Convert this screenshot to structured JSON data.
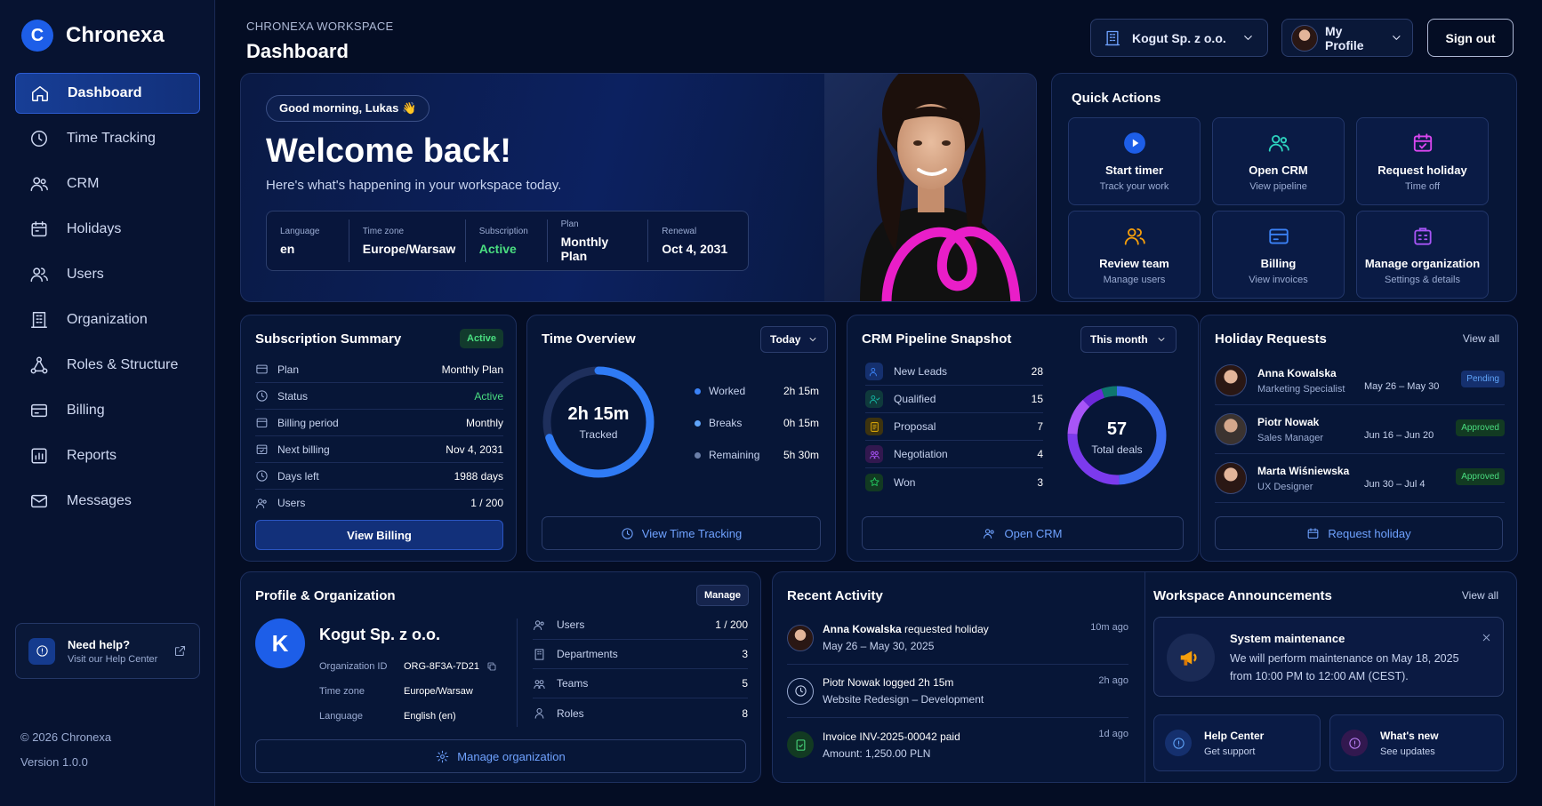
{
  "brand": {
    "name": "Chronexa",
    "logo_letter": "C"
  },
  "nav": {
    "items": [
      {
        "label": "Dashboard",
        "icon": "home-icon"
      },
      {
        "label": "Time Tracking",
        "icon": "clock-icon"
      },
      {
        "label": "CRM",
        "icon": "users-icon"
      },
      {
        "label": "Holidays",
        "icon": "calendar-icon"
      },
      {
        "label": "Users",
        "icon": "user-icon"
      },
      {
        "label": "Organization",
        "icon": "building-icon"
      },
      {
        "label": "Roles & Structure",
        "icon": "hierarchy-icon"
      },
      {
        "label": "Billing",
        "icon": "card-icon"
      },
      {
        "label": "Reports",
        "icon": "chart-icon"
      },
      {
        "label": "Messages",
        "icon": "mail-icon"
      }
    ]
  },
  "help": {
    "title": "Need help?",
    "subtitle": "Visit our Help Center"
  },
  "footer": {
    "copyright": "© 2026 Chronexa",
    "version": "Version 1.0.0"
  },
  "header": {
    "workspace_label": "CHRONEXA WORKSPACE",
    "title": "Dashboard",
    "org_select": "Kogut Sp. z o.o.",
    "profile": "My Profile",
    "sign_out": "Sign out"
  },
  "hero": {
    "greeting": "Good morning, Lukas 👋",
    "title": "Welcome back!",
    "subtitle": "Here's what's happening in your workspace today.",
    "stats": [
      {
        "label": "Language",
        "value": "en"
      },
      {
        "label": "Time zone",
        "value": "Europe/Warsaw"
      },
      {
        "label": "Subscription",
        "value": "Active"
      },
      {
        "label": "Plan",
        "value": "Monthly Plan"
      },
      {
        "label": "Renewal",
        "value": "Oct 4, 2031"
      }
    ]
  },
  "quick_actions": {
    "title": "Quick Actions",
    "items": [
      {
        "title": "Start timer",
        "sub": "Track your work"
      },
      {
        "title": "Open CRM",
        "sub": "View pipeline"
      },
      {
        "title": "Request holiday",
        "sub": "Time off"
      },
      {
        "title": "Review team",
        "sub": "Manage users"
      },
      {
        "title": "Billing",
        "sub": "View invoices"
      },
      {
        "title": "Manage organization",
        "sub": "Settings & details"
      }
    ]
  },
  "subscription": {
    "title": "Subscription Summary",
    "badge": "Active",
    "rows": [
      {
        "label": "Plan",
        "value": "Monthly Plan"
      },
      {
        "label": "Status",
        "value": "Active"
      },
      {
        "label": "Billing period",
        "value": "Monthly"
      },
      {
        "label": "Next billing",
        "value": "Nov 4, 2031"
      },
      {
        "label": "Days left",
        "value": "1988 days"
      },
      {
        "label": "Users",
        "value": "1 / 200"
      }
    ],
    "button": "View Billing"
  },
  "time_overview": {
    "title": "Time Overview",
    "range": "Today",
    "total": "2h 15m",
    "total_label": "Tracked",
    "tracked_fraction": 0.7,
    "legend": [
      {
        "label": "Worked",
        "value": "2h 15m",
        "color": "#3b82f6"
      },
      {
        "label": "Breaks",
        "value": "0h 15m",
        "color": "#60a5fa"
      },
      {
        "label": "Remaining",
        "value": "5h 30m",
        "color": "#6b7fa8"
      }
    ],
    "button": "View Time Tracking"
  },
  "crm": {
    "title": "CRM Pipeline Snapshot",
    "range": "This month",
    "rows": [
      {
        "label": "New Leads",
        "value": "28",
        "color": "#3b82f6"
      },
      {
        "label": "Qualified",
        "value": "15",
        "color": "#14b8a6"
      },
      {
        "label": "Proposal",
        "value": "7",
        "color": "#eab308"
      },
      {
        "label": "Negotiation",
        "value": "4",
        "color": "#a855f7"
      },
      {
        "label": "Won",
        "value": "3",
        "color": "#22c55e"
      }
    ],
    "total": "57",
    "total_label": "Total deals",
    "button": "Open CRM"
  },
  "holidays": {
    "title": "Holiday Requests",
    "view_all": "View all",
    "rows": [
      {
        "name": "Anna Kowalska",
        "role": "Marketing Specialist",
        "dates": "May 26 – May 30",
        "status": "Pending",
        "status_color": "#60a5fa"
      },
      {
        "name": "Piotr Nowak",
        "role": "Sales Manager",
        "dates": "Jun 16 – Jun 20",
        "status": "Approved",
        "status_color": "#4ade80"
      },
      {
        "name": "Marta Wiśniewska",
        "role": "UX Designer",
        "dates": "Jun 30 – Jul 4",
        "status": "Approved",
        "status_color": "#4ade80"
      }
    ],
    "button": "Request holiday"
  },
  "profile_org": {
    "title": "Profile & Organization",
    "manage": "Manage",
    "avatar_letter": "K",
    "org_name": "Kogut Sp. z o.o.",
    "details": [
      {
        "label": "Organization ID",
        "value": "ORG-8F3A-7D21"
      },
      {
        "label": "Time zone",
        "value": "Europe/Warsaw"
      },
      {
        "label": "Language",
        "value": "English (en)"
      }
    ],
    "counts": [
      {
        "label": "Users",
        "value": "1 / 200"
      },
      {
        "label": "Departments",
        "value": "3"
      },
      {
        "label": "Teams",
        "value": "5"
      },
      {
        "label": "Roles",
        "value": "8"
      }
    ],
    "button": "Manage organization"
  },
  "activity": {
    "title": "Recent Activity",
    "items": [
      {
        "actor": "Anna Kowalska",
        "action": " requested holiday",
        "sub": "May 26 – May 30, 2025",
        "time": "10m ago"
      },
      {
        "actor": "",
        "action": "Piotr Nowak logged 2h 15m",
        "sub": "Website Redesign – Development",
        "time": "2h ago"
      },
      {
        "actor": "",
        "action": "Invoice INV-2025-00042 paid",
        "sub": "Amount: 1,250.00 PLN",
        "time": "1d ago"
      }
    ]
  },
  "announcements": {
    "title": "Workspace Announcements",
    "view_all": "View all",
    "item_title": "System maintenance",
    "item_body_1": "We will perform maintenance on May 18, 2025",
    "item_body_2": "from 10:00 PM to 12:00 AM (CEST).",
    "links": [
      {
        "title": "Help Center",
        "sub": "Get support"
      },
      {
        "title": "What's new",
        "sub": "See updates"
      }
    ]
  },
  "colors": {
    "accent": "#1d5ee8",
    "active_green": "#4ade80",
    "link_blue": "#6fa2ff"
  }
}
